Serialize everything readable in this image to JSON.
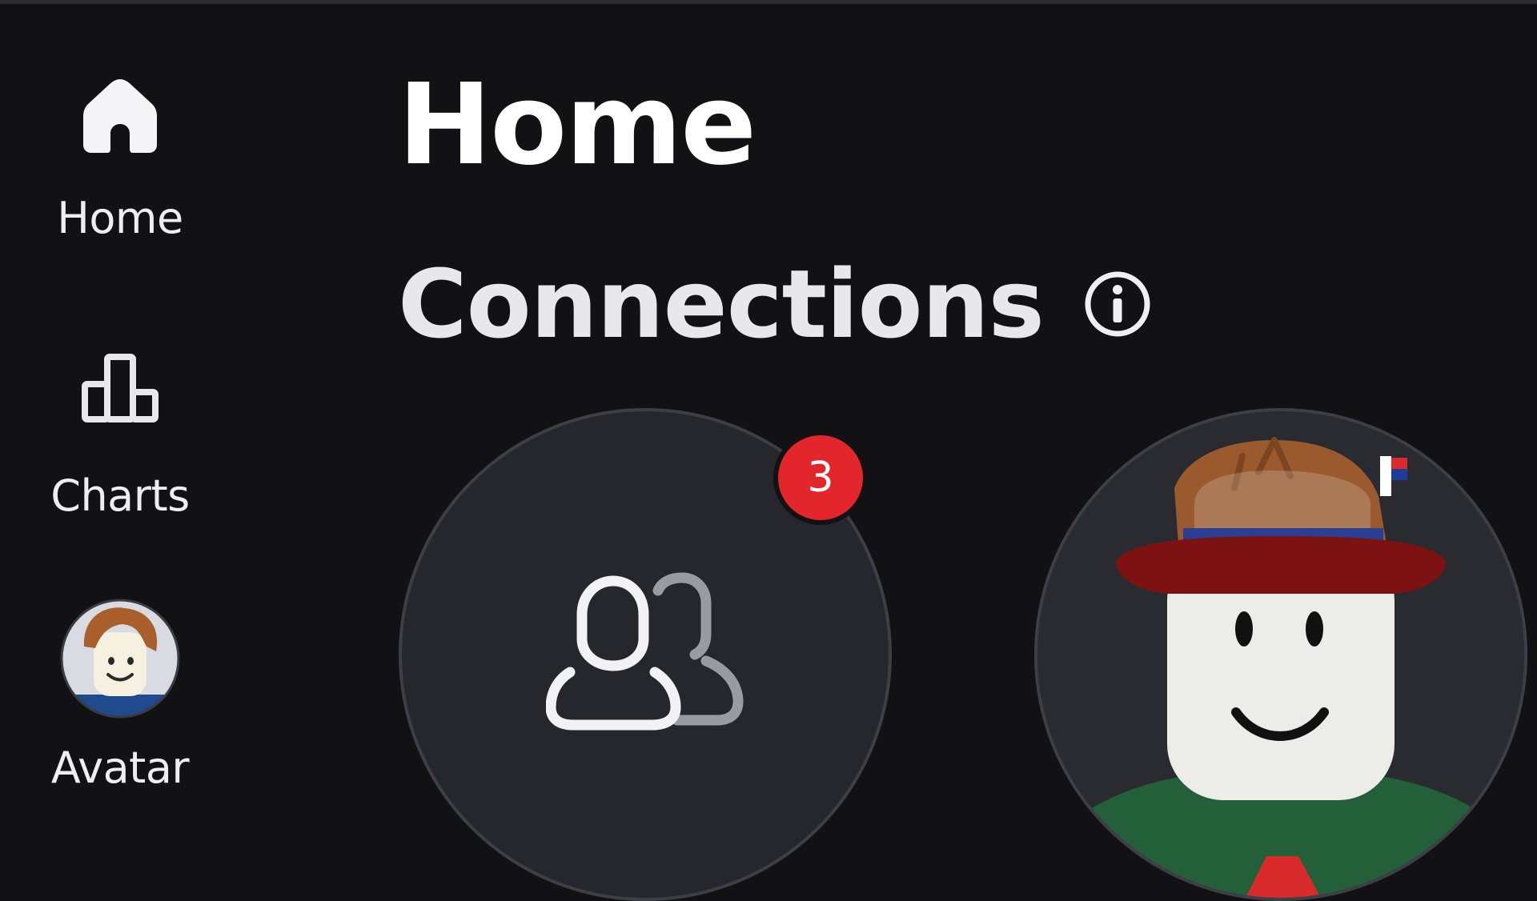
{
  "sidebar": {
    "items": [
      {
        "label": "Home",
        "icon": "home-icon"
      },
      {
        "label": "Charts",
        "icon": "bar-chart-icon"
      },
      {
        "label": "Avatar",
        "icon": "avatar-thumbnail"
      }
    ]
  },
  "main": {
    "page_title": "Home",
    "section_title": "Connections",
    "section_info_icon": "info-icon",
    "tiles": [
      {
        "icon": "people-icon",
        "badge_count": "3"
      },
      {
        "icon": "friend-avatar"
      }
    ]
  },
  "colors": {
    "background": "#121215",
    "tile": "#26272d",
    "badge": "#e3262b"
  }
}
